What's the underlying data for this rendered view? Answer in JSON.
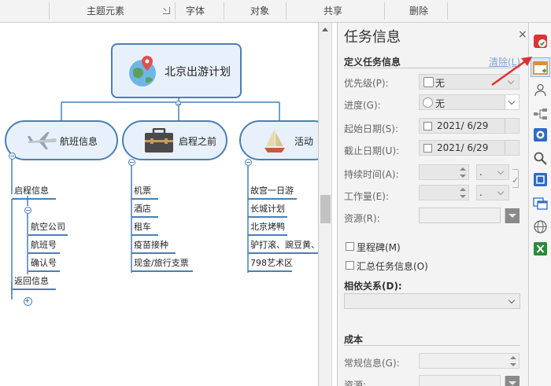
{
  "ribbon": {
    "groups": [
      "主题元素",
      "字体",
      "对象",
      "共享",
      "删除"
    ]
  },
  "mindmap": {
    "root": "北京出游计划",
    "topics": [
      {
        "label": "航班信息",
        "icon": "airplane-icon"
      },
      {
        "label": "启程之前",
        "icon": "suitcase-icon"
      },
      {
        "label": "活动",
        "icon": "sailboat-icon"
      }
    ],
    "flight": {
      "departure": "启程信息",
      "departure_children": [
        "航空公司",
        "航班号",
        "确认号"
      ],
      "return": "返回信息"
    },
    "before": [
      "机票",
      "酒店",
      "租车",
      "疫苗接种",
      "现金/旅行支票"
    ],
    "activities": [
      "故宫一日游",
      "长城计划",
      "北京烤鸭",
      "驴打滚、豌豆黄、",
      "798艺术区"
    ]
  },
  "task_panel": {
    "title": "任务信息",
    "close": "×",
    "define_section": "定义任务信息",
    "clear_link": "清除(L)",
    "priority_label": "优先级(P):",
    "priority_value": "无",
    "progress_label": "进度(G):",
    "progress_value": "无",
    "start_label": "起始日期(S):",
    "start_value": "2021/ 6/29",
    "end_label": "截止日期(U):",
    "end_value": "2021/ 6/29",
    "duration_label": "持续时间(A):",
    "duration_unit": ".",
    "work_label": "工作量(E):",
    "work_unit": ".",
    "resource_label": "资源(R):",
    "milestone_label": "里程碑(M)",
    "summary_label": "汇总任务信息(O)",
    "dependency_label": "相依关系(D):",
    "cost_section": "成本",
    "regular_label": "常规信息(G):",
    "resource2_label": "资源:"
  },
  "colors": {
    "node_fill": "#e8f1fb",
    "node_border": "#4a7fb6",
    "accent_red": "#e03030"
  }
}
